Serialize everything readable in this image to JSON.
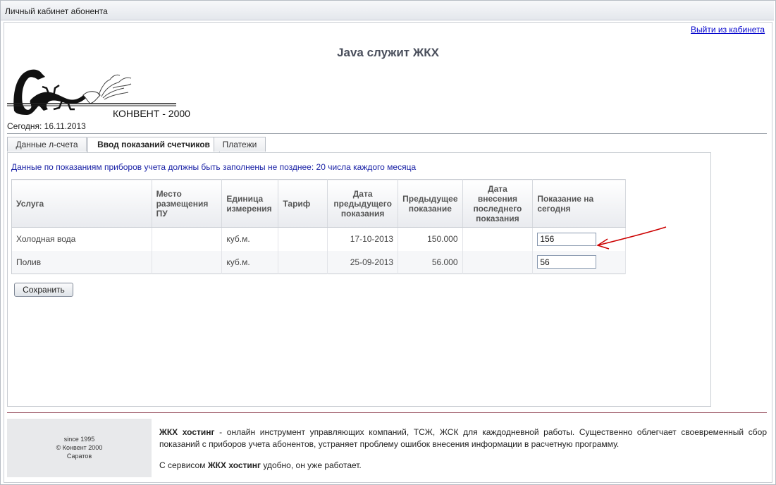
{
  "window": {
    "title": "Личный кабинет абонента"
  },
  "header": {
    "logout_label": "Выйти из кабинета",
    "site_title": "Java служит ЖКХ",
    "logo_text": "КОНВЕНТ - 2000",
    "today": "Сегодня: 16.11.2013"
  },
  "tabs": [
    {
      "label": "Данные л-счета",
      "active": false
    },
    {
      "label": "Ввод показаний счетчиков",
      "active": true
    },
    {
      "label": "Платежи",
      "active": false
    }
  ],
  "main": {
    "notice": "Данные по показаниям приборов учета должны быть заполнены не позднее: 20 числа каждого месяца",
    "columns": [
      "Услуга",
      "Место размещения ПУ",
      "Единица измерения",
      "Тариф",
      "Дата предыдущего показания",
      "Предыдущее показание",
      "Дата внесения последнего показания",
      "Показание на сегодня"
    ],
    "rows": [
      {
        "service": "Холодная вода",
        "location": "",
        "unit": "куб.м.",
        "tariff": "",
        "prev_date": "17-10-2013",
        "prev_value": "150.000",
        "last_entry_date": "",
        "today_value": "156"
      },
      {
        "service": "Полив",
        "location": "",
        "unit": "куб.м.",
        "tariff": "",
        "prev_date": "25-09-2013",
        "prev_value": "56.000",
        "last_entry_date": "",
        "today_value": "56"
      }
    ],
    "save_label": "Сохранить"
  },
  "footer": {
    "since": "since 1995",
    "copyright": "© Конвент 2000",
    "city": "Саратов",
    "brand": "ЖКХ хостинг",
    "description": " - онлайн инструмент управляющих компаний, ТСЖ, ЖСК для каждодневной работы. Существенно облегчает своевременный сбор показаний с приборов учета абонентов, устраняет проблему ошибок внесения информации в расчетную программу.",
    "service_prefix": "С сервисом ",
    "service_suffix": " удобно, он уже работает."
  },
  "colors": {
    "notice": "#1a22a6",
    "link": "#0000cc",
    "title": "#4a4f5c",
    "arrow": "#cc0000",
    "footer_line": "#8b3a4a"
  },
  "icons": [
    "salamander-logo",
    "red-arrow-annotation"
  ]
}
